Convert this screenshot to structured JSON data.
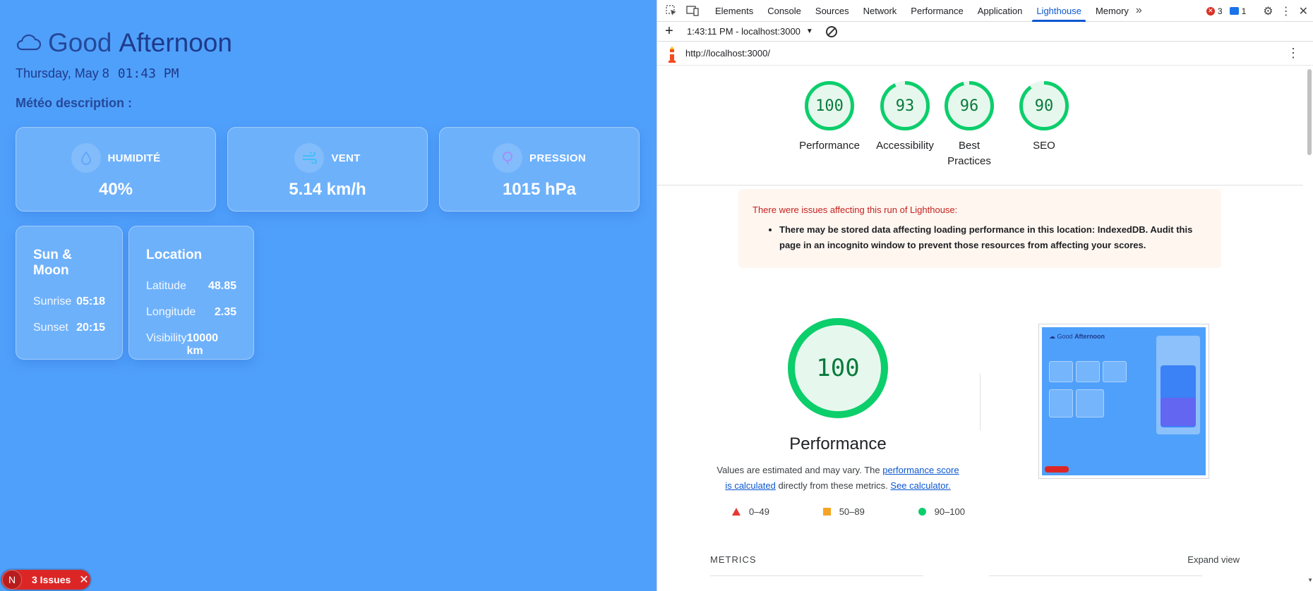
{
  "app": {
    "greeting_light": "Good",
    "greeting_strong": "Afternoon",
    "date": "Thursday, May 8",
    "time": "01:43 PM",
    "meteo_label": "Météo description :",
    "stats": [
      {
        "label": "HUMIDITÉ",
        "value": "40%",
        "icon": "droplet-icon"
      },
      {
        "label": "VENT",
        "value": "5.14 km/h",
        "icon": "wind-icon"
      },
      {
        "label": "PRESSION",
        "value": "1015 hPa",
        "icon": "gauge-icon"
      }
    ],
    "sun_moon": {
      "title": "Sun & Moon",
      "rows": [
        {
          "label": "Sunrise",
          "value": "05:18"
        },
        {
          "label": "Sunset",
          "value": "20:15"
        }
      ]
    },
    "location": {
      "title": "Location",
      "rows": [
        {
          "label": "Latitude",
          "value": "48.85"
        },
        {
          "label": "Longitude",
          "value": "2.35"
        },
        {
          "label": "Visibility",
          "value": "10000 km"
        }
      ]
    },
    "issues_badge": {
      "initial": "N",
      "label": "3 Issues"
    }
  },
  "devtools": {
    "tabs": [
      "Elements",
      "Console",
      "Sources",
      "Network",
      "Performance",
      "Application",
      "Lighthouse",
      "Memory"
    ],
    "active_tab": "Lighthouse",
    "error_count": "3",
    "message_count": "1",
    "report_selector": "1:43:11 PM - localhost:3000",
    "url": "http://localhost:3000/",
    "scores": [
      {
        "name": "Performance",
        "score": 100
      },
      {
        "name": "Accessibility",
        "score": 93
      },
      {
        "name": "Best Practices",
        "score": 96
      },
      {
        "name": "SEO",
        "score": 90
      }
    ],
    "warning": {
      "title": "There were issues affecting this run of Lighthouse:",
      "item": "There may be stored data affecting loading performance in this location: IndexedDB. Audit this page in an incognito window to prevent those resources from affecting your scores."
    },
    "performance": {
      "score": "100",
      "title": "Performance",
      "desc_prefix": "Values are estimated and may vary. The ",
      "desc_link1": "performance score is calculated",
      "desc_mid": " directly from these metrics. ",
      "desc_link2": "See calculator."
    },
    "legend": [
      {
        "range": "0–49",
        "shape": "triangle",
        "color": "#e53935"
      },
      {
        "range": "50–89",
        "shape": "square",
        "color": "#f5a524"
      },
      {
        "range": "90–100",
        "shape": "circle",
        "color": "#0cce6b"
      }
    ],
    "thumbnail": {
      "greeting_light": "Good",
      "greeting_strong": "Afternoon"
    },
    "metrics_label": "METRICS",
    "expand_label": "Expand view",
    "colors": {
      "accent": "#0b57d0",
      "good": "#0cce6b",
      "app_bg": "#4fa0fb"
    }
  }
}
